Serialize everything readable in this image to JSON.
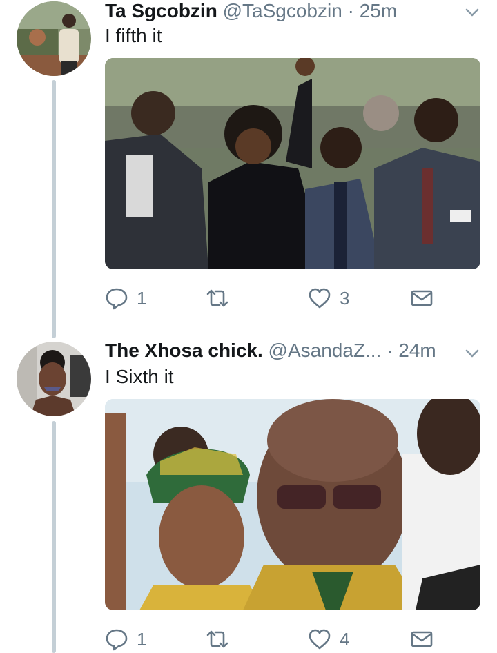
{
  "tweets": [
    {
      "name": "Ta Sgcobzin",
      "handle": "@TaSgcobzin",
      "separator": "·",
      "time": "25m",
      "text": "I fifth it",
      "replies": "1",
      "retweets": "",
      "likes": "3"
    },
    {
      "name": "The Xhosa chick.",
      "handle": "@AsandaZ...",
      "separator": "·",
      "time": "24m",
      "text": "I Sixth it",
      "replies": "1",
      "retweets": "",
      "likes": "4"
    }
  ],
  "icons": {
    "reply": "reply-icon",
    "retweet": "retweet-icon",
    "like": "heart-icon",
    "message": "envelope-icon",
    "menu": "chevron-down-icon"
  },
  "colors": {
    "text": "#14171a",
    "secondary": "#657786",
    "thread_line": "#c4cfd6"
  }
}
